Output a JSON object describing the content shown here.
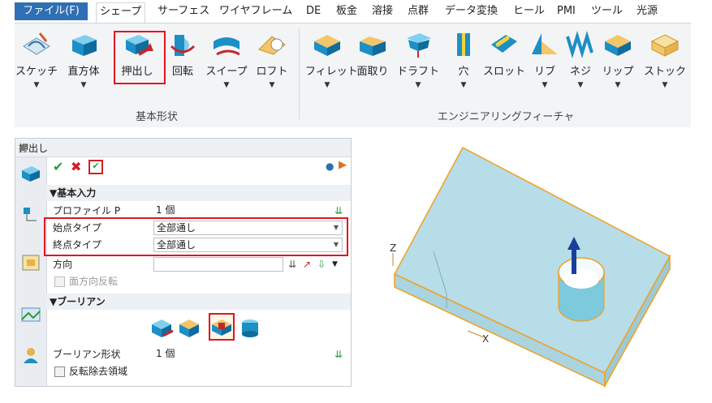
{
  "menu": {
    "tabs": [
      "ファイル(F)",
      "シェープ",
      "サーフェス",
      "ワイヤフレーム",
      "DE",
      "板金",
      "溶接",
      "点群",
      "データ変換",
      "ヒール",
      "PMI",
      "ツール",
      "光源"
    ]
  },
  "ribbon": {
    "basic_group_label": "基本形状",
    "feature_group_label": "エンジニアリングフィーチャ",
    "buttons": [
      "スケッチ",
      "直方体",
      "押出し",
      "回転",
      "スイープ",
      "ロフト",
      "フィレット",
      "面取り",
      "ドラフト",
      "穴",
      "スロット",
      "リブ",
      "ネジ",
      "リップ",
      "ストック"
    ]
  },
  "panel": {
    "title": "押出し",
    "section_basic": "▼基本入力",
    "profile_label": "プロファイル P",
    "profile_value": "1 個",
    "start_type_label": "始点タイプ",
    "start_type_value": "全部通し",
    "end_type_label": "終点タイプ",
    "end_type_value": "全部通し",
    "direction_label": "方向",
    "flip_label": "面方向反転",
    "section_boolean": "▼ブーリアン",
    "boolean_shape_label": "ブーリアン形状",
    "boolean_shape_value": "1 個",
    "reverse_remove_label": "反転除去領域"
  },
  "viewport": {
    "axis_z": "Z",
    "axis_x": "X"
  },
  "colors": {
    "file_tab": "#2e6fb5",
    "highlight": "#e0161f",
    "model_fill": "#b7dde8",
    "model_edge": "#f0a020"
  }
}
